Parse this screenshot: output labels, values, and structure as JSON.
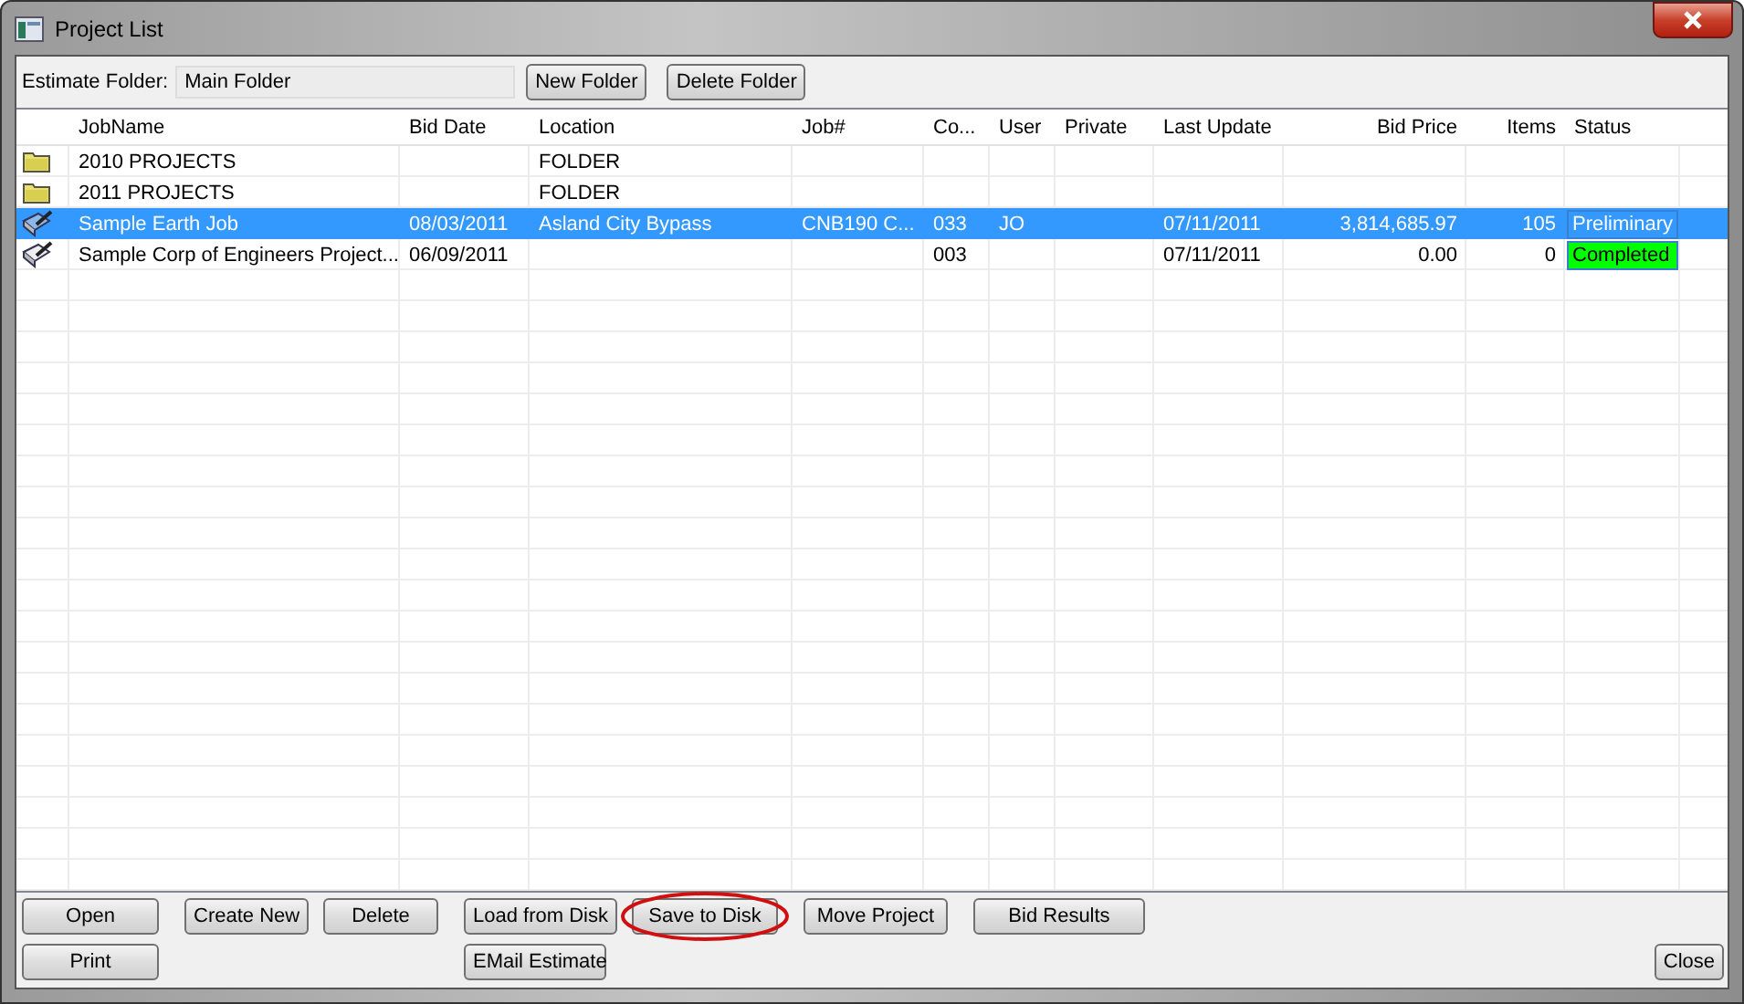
{
  "window": {
    "title": "Project List"
  },
  "folder_bar": {
    "label": "Estimate Folder:",
    "value": "Main Folder",
    "buttons": [
      "New Folder",
      "Delete Folder"
    ]
  },
  "table": {
    "columns": [
      "JobName",
      "Bid Date",
      "Location",
      "Job#",
      "Co...",
      "User",
      "Private",
      "Last Update",
      "Bid Price",
      "Items",
      "Status"
    ],
    "rows": [
      {
        "kind": "folder",
        "selected": false,
        "cells": [
          "2010 PROJECTS",
          "",
          "FOLDER",
          "",
          "",
          "",
          "",
          "",
          "",
          "",
          ""
        ]
      },
      {
        "kind": "folder",
        "selected": false,
        "cells": [
          "2011 PROJECTS",
          "",
          "FOLDER",
          "",
          "",
          "",
          "",
          "",
          "",
          "",
          ""
        ]
      },
      {
        "kind": "job",
        "selected": true,
        "color": "#3399ff",
        "cells": [
          "Sample Earth Job",
          "08/03/2011",
          "Asland City Bypass",
          "CNB190 C...",
          "033",
          "JO",
          "",
          "07/11/2011",
          "3,814,685.97",
          "105",
          "Preliminary"
        ]
      },
      {
        "kind": "job",
        "selected": false,
        "color": "#00ff00",
        "cells": [
          "Sample Corp of Engineers Project...",
          "06/09/2011",
          "",
          "",
          "003",
          "",
          "",
          "07/11/2011",
          "0.00",
          "0",
          "Completed"
        ]
      }
    ]
  },
  "buttons_row_1": [
    {
      "label": "Open",
      "circled": false
    },
    {
      "label": "Create New",
      "circled": false
    },
    {
      "label": "Delete",
      "circled": false
    },
    {
      "label": "Load from Disk",
      "circled": false
    },
    {
      "label": "Save to Disk",
      "circled": true
    },
    {
      "label": "Move Project",
      "circled": false
    },
    {
      "label": "Bid Results",
      "circled": false
    }
  ],
  "buttons_row_2": [
    "Print",
    "EMail Estimate",
    "Close"
  ]
}
